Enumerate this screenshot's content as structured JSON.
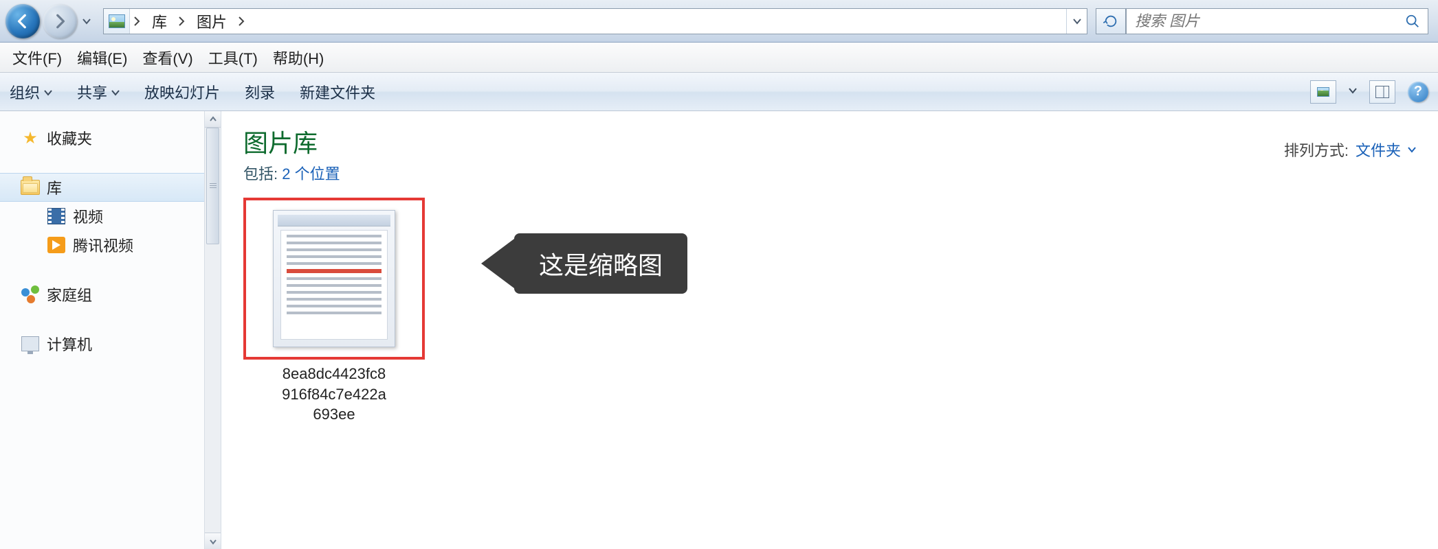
{
  "breadcrumbs": {
    "root": "库",
    "current": "图片"
  },
  "search": {
    "placeholder": "搜索 图片"
  },
  "menu": {
    "file": "文件(F)",
    "edit": "编辑(E)",
    "view": "查看(V)",
    "tools": "工具(T)",
    "help": "帮助(H)"
  },
  "toolbar": {
    "organize": "组织",
    "share": "共享",
    "slideshow": "放映幻灯片",
    "burn": "刻录",
    "new_folder": "新建文件夹"
  },
  "sidebar": {
    "favorites": "收藏夹",
    "libraries": "库",
    "videos": "视频",
    "tencent_video": "腾讯视频",
    "homegroup": "家庭组",
    "computer": "计算机"
  },
  "library": {
    "title": "图片库",
    "includes_prefix": "包括: ",
    "includes_link": "2 个位置",
    "arrange_label": "排列方式:",
    "arrange_value": "文件夹"
  },
  "item": {
    "name_line1": "8ea8dc4423fc8",
    "name_line2": "916f84c7e422a",
    "name_line3": "693ee"
  },
  "callout": {
    "text": "这是缩略图"
  }
}
